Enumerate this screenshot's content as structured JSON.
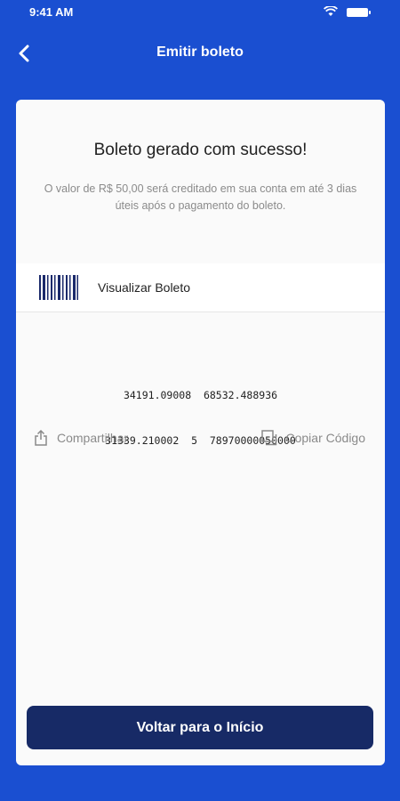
{
  "status": {
    "time": "9:41 AM"
  },
  "header": {
    "title": "Emitir boleto"
  },
  "card": {
    "success_title": "Boleto gerado com sucesso!",
    "description": "O valor de R$ 50,00 será creditado em sua conta em até 3 dias úteis após o pagamento do boleto.",
    "view_label": "Visualizar Boleto",
    "barcode_line1": "34191.09008  68532.488936",
    "barcode_line2": "31339.210002  5  78970000050000",
    "share_label": "Compartilhar",
    "copy_label": "Copiar Código",
    "home_button": "Voltar para o Início"
  },
  "icons": {
    "back": "chevron-left-icon",
    "barcode": "barcode-icon",
    "share": "share-icon",
    "copy": "copy-icon",
    "wifi": "wifi-icon",
    "battery": "battery-icon"
  },
  "colors": {
    "background": "#1a4fd1",
    "primary_button": "#172a66",
    "card": "#fafafa"
  }
}
